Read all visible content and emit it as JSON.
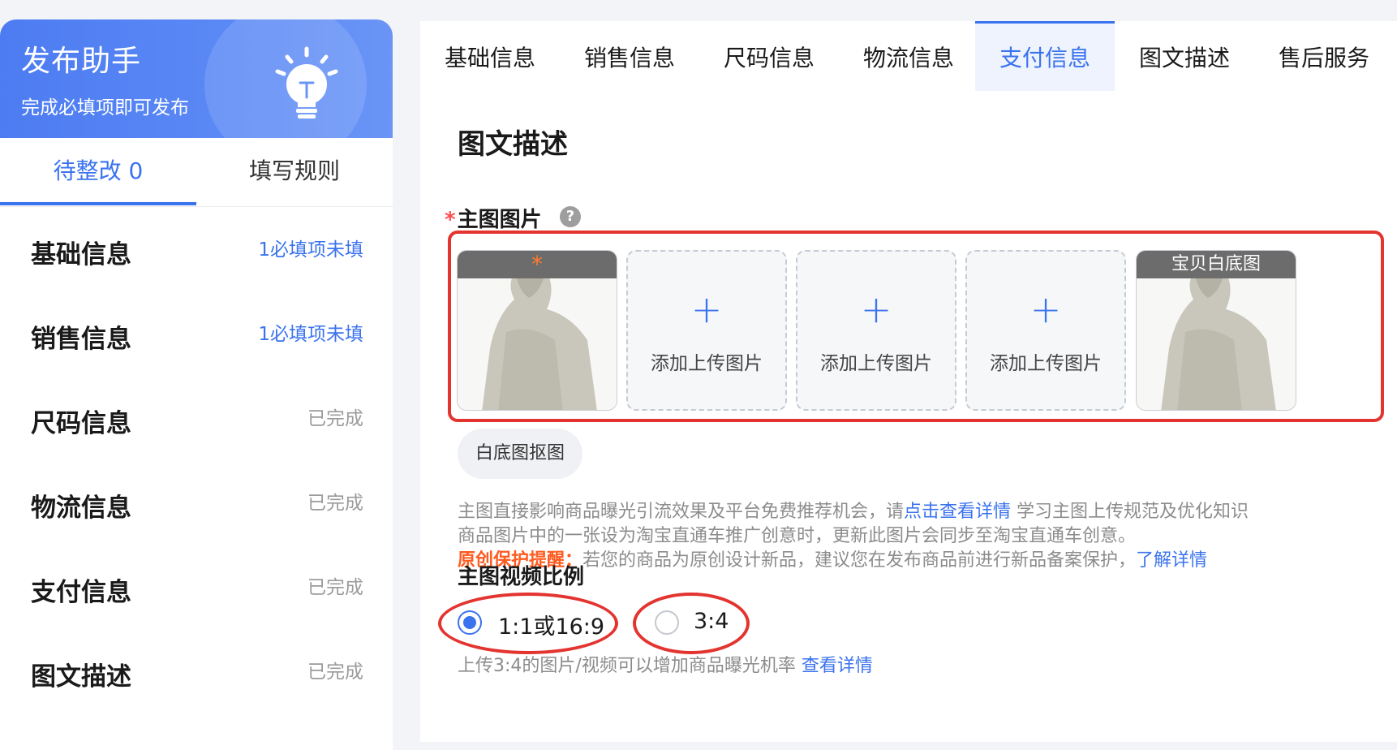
{
  "sidebar": {
    "title": "发布助手",
    "subtitle": "完成必填项即可发布",
    "tabs": [
      {
        "label": "待整改 0"
      },
      {
        "label": "填写规则"
      }
    ],
    "items": [
      {
        "label": "基础信息",
        "status": "1必填项未填"
      },
      {
        "label": "销售信息",
        "status": "1必填项未填"
      },
      {
        "label": "尺码信息",
        "status": "已完成"
      },
      {
        "label": "物流信息",
        "status": "已完成"
      },
      {
        "label": "支付信息",
        "status": "已完成"
      },
      {
        "label": "图文描述",
        "status": "已完成"
      }
    ]
  },
  "tabs": [
    {
      "label": "基础信息"
    },
    {
      "label": "销售信息"
    },
    {
      "label": "尺码信息"
    },
    {
      "label": "物流信息"
    },
    {
      "label": "支付信息",
      "active": true
    },
    {
      "label": "图文描述"
    },
    {
      "label": "售后服务"
    }
  ],
  "section": {
    "title": "图文描述",
    "main_image_label": "主图图片",
    "required_mark": "*",
    "help_glyph": "?",
    "slots": {
      "first_badge": "*",
      "add_icon": "+",
      "add_label": "添加上传图片",
      "white_bg_badge": "宝贝白底图"
    },
    "cutout_button": "白底图抠图",
    "desc_line1_pre": "主图直接影响商品曝光引流效果及平台免费推荐机会，请",
    "desc_line1_link": "点击查看详情",
    "desc_line1_post": " 学习主图上传规范及优化知识",
    "desc_line2": "商品图片中的一张设为淘宝直通车推广创意时，更新此图片会同步至淘宝直通车创意。",
    "warn_label": "原创保护提醒：",
    "warn_text": "若您的商品为原创设计新品，建议您在发布商品前进行新品备案保护，",
    "warn_link": "了解详情",
    "video_ratio_label": "主图视频比例",
    "ratio_options": [
      "1:1或16:9",
      "3:4"
    ],
    "ratio_selected": "1:1或16:9",
    "ratio_tip": "上传3:4的图片/视频可以增加商品曝光机率 ",
    "ratio_tip_link": "查看详情"
  },
  "colors": {
    "accent": "#3b73ee",
    "highlight": "#e3342f",
    "warning": "#ff5a1f"
  }
}
